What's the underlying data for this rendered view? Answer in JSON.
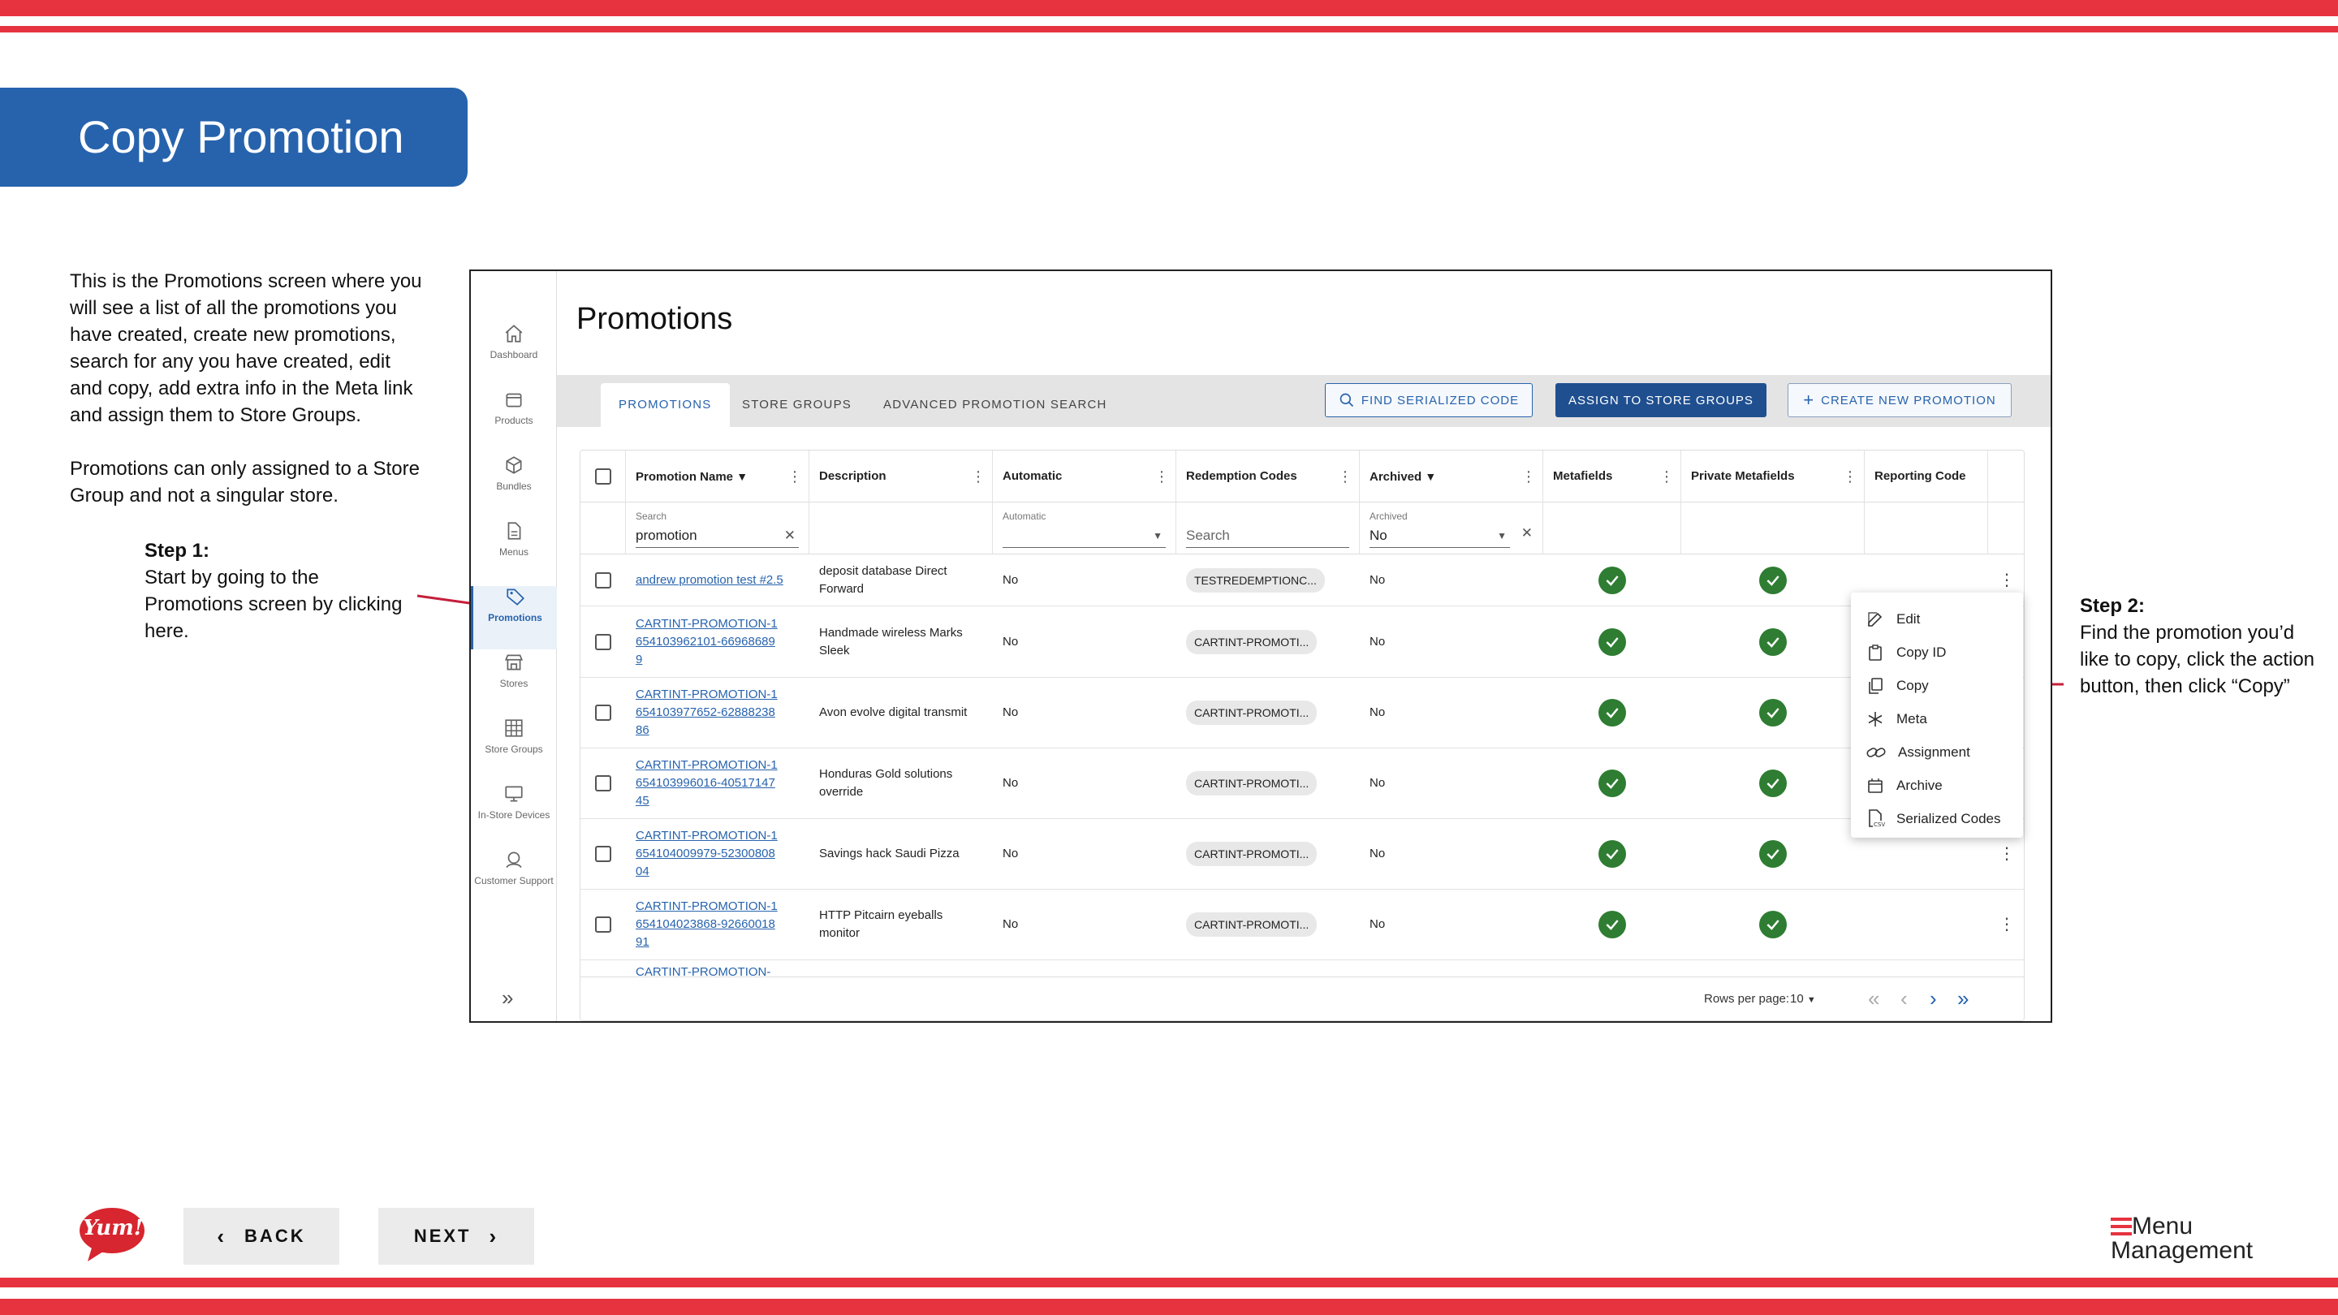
{
  "slide": {
    "title": "Copy Promotion",
    "desc_p1": "This is the Promotions screen where you will see a list of all the promotions you have created, create new promotions, search for any you have created, edit and copy, add extra info in the Meta link and assign them to Store Groups.",
    "desc_p2": "Promotions can only assigned to a Store Group and not a singular store.",
    "step1_title": "Step 1:",
    "step1_text": "Start by going to the Promotions screen by clicking here.",
    "step2_title": "Step 2:",
    "step2_text": "Find the promotion you’d like to copy, click the action button, then click “Copy”",
    "back_label": "BACK",
    "next_label": "NEXT",
    "logo_text": "Yum!",
    "brand_line1": "Menu",
    "brand_line2": "Management",
    "accent_red": "#e6333f",
    "accent_blue": "#2763ad"
  },
  "app": {
    "nav": [
      {
        "label": "Dashboard",
        "icon": "home-icon"
      },
      {
        "label": "Products",
        "icon": "box-icon"
      },
      {
        "label": "Bundles",
        "icon": "cube-icon"
      },
      {
        "label": "Menus",
        "icon": "document-icon"
      },
      {
        "label": "Promotions",
        "icon": "tag-icon",
        "active": true
      },
      {
        "label": "Stores",
        "icon": "store-icon"
      },
      {
        "label": "Store Groups",
        "icon": "grid-icon"
      },
      {
        "label": "In-Store Devices",
        "icon": "monitor-icon"
      },
      {
        "label": "Customer Support",
        "icon": "support-icon"
      }
    ],
    "page_title": "Promotions",
    "tabs": [
      "PROMOTIONS",
      "STORE GROUPS",
      "ADVANCED PROMOTION SEARCH"
    ],
    "buttons": {
      "find": "FIND SERIALIZED CODE",
      "assign": "ASSIGN TO STORE GROUPS",
      "create": "CREATE NEW PROMOTION"
    },
    "columns": [
      "Promotion Name",
      "Description",
      "Automatic",
      "Redemption Codes",
      "Archived",
      "Metafields",
      "Private Metafields",
      "Reporting Code"
    ],
    "filters": {
      "name_label": "Search",
      "name_value": "promotion",
      "automatic_label": "Automatic",
      "codes_placeholder": "Search",
      "archived_label": "Archived",
      "archived_value": "No"
    },
    "rows": [
      {
        "name": "andrew promotion test #2.5",
        "description": "deposit database Direct Forward",
        "automatic": "No",
        "code": "TESTREDEMPTIONC...",
        "archived": "No"
      },
      {
        "name": "CARTINT-PROMOTION-1654103962101-669686899",
        "description": "Handmade wireless Marks Sleek",
        "automatic": "No",
        "code": "CARTINT-PROMOTI...",
        "archived": "No"
      },
      {
        "name": "CARTINT-PROMOTION-1654103977652-6288823886",
        "description": "Avon evolve digital transmit",
        "automatic": "No",
        "code": "CARTINT-PROMOTI...",
        "archived": "No"
      },
      {
        "name": "CARTINT-PROMOTION-1654103996016-4051714745",
        "description": "Honduras Gold solutions override",
        "automatic": "No",
        "code": "CARTINT-PROMOTI...",
        "archived": "No"
      },
      {
        "name": "CARTINT-PROMOTION-1654104009979-5230080804",
        "description": "Savings hack Saudi Pizza",
        "automatic": "No",
        "code": "CARTINT-PROMOTI...",
        "archived": "No"
      },
      {
        "name": "CARTINT-PROMOTION-1654104023868-9266001891",
        "description": "HTTP Pitcairn eyeballs monitor",
        "automatic": "No",
        "code": "CARTINT-PROMOTI...",
        "archived": "No"
      }
    ],
    "partial_row": "CARTINT-PROMOTION-",
    "footer": {
      "rows_per_page_label": "Rows per page:",
      "rows_per_page_value": "10"
    },
    "action_menu": [
      "Edit",
      "Copy ID",
      "Copy",
      "Meta",
      "Assignment",
      "Archive",
      "Serialized Codes"
    ]
  }
}
